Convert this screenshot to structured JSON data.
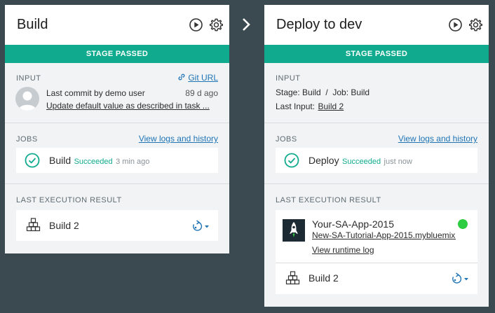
{
  "stages": {
    "build": {
      "title": "Build",
      "status": "STAGE PASSED",
      "input": {
        "label": "INPUT",
        "git_link": "Git URL",
        "commit_text": "Last commit by demo user",
        "commit_age": "89 d ago",
        "commit_message": "Update default value as described in task ..."
      },
      "jobs": {
        "label": "JOBS",
        "logs_link": "View logs and history",
        "items": [
          {
            "name": "Build",
            "status": "Succeeded",
            "time": "3 min ago"
          }
        ]
      },
      "last_result": {
        "label": "LAST EXECUTION RESULT",
        "artifact": "Build 2"
      }
    },
    "deploy": {
      "title": "Deploy to dev",
      "status": "STAGE PASSED",
      "input": {
        "label": "INPUT",
        "stage_line": "Stage: Build  /  Job: Build",
        "last_input_label": "Last Input:",
        "last_input_link": "Build 2"
      },
      "jobs": {
        "label": "JOBS",
        "logs_link": "View logs and history",
        "items": [
          {
            "name": "Deploy",
            "status": "Succeeded",
            "time": "just now"
          }
        ]
      },
      "last_result": {
        "label": "LAST EXECUTION RESULT",
        "app_name": "Your-SA-App-2015",
        "app_url": "New-SA-Tutorial-App-2015.mybluemix.net",
        "runtime_link": "View runtime log",
        "artifact": "Build 2"
      }
    }
  },
  "colors": {
    "background": "#3b4a51",
    "passed": "#10ab8e",
    "link": "#1f74b5",
    "app_running": "#2ecc40"
  }
}
